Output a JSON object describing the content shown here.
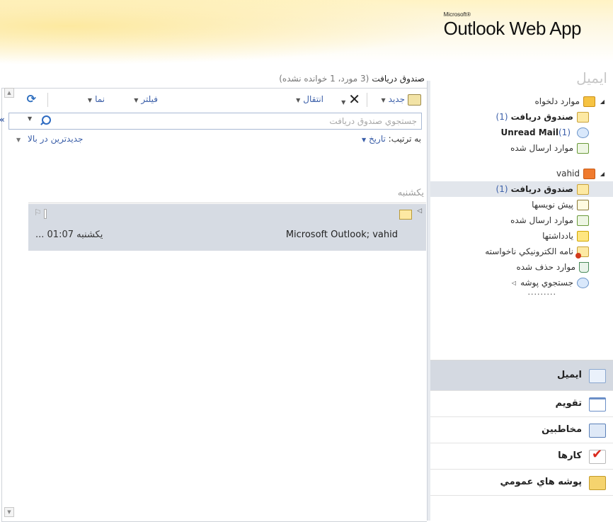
{
  "header": {
    "brand_small": "Microsoft®",
    "brand_app": "Outlook Web App"
  },
  "folder_pane": {
    "title": "ايميل",
    "favorites": {
      "label": "موارد دلخواه",
      "items": [
        {
          "label": "صندوق دريافت",
          "count": "(1)",
          "bold": true,
          "icon": "inbox-icon"
        },
        {
          "label": "Unread Mail",
          "count": "(1)",
          "bold": true,
          "icon": "search-folder-icon"
        },
        {
          "label": "موارد ارسال شده",
          "count": "",
          "bold": false,
          "icon": "sent-icon"
        }
      ]
    },
    "mailbox": {
      "label": "vahid",
      "items": [
        {
          "label": "صندوق دريافت",
          "count": "(1)",
          "bold": true,
          "selected": true,
          "icon": "inbox-icon"
        },
        {
          "label": "پيش نويسها",
          "count": "",
          "bold": false,
          "icon": "drafts-icon"
        },
        {
          "label": "موارد ارسال شده",
          "count": "",
          "bold": false,
          "icon": "sent-icon"
        },
        {
          "label": "يادداشتها",
          "count": "",
          "bold": false,
          "icon": "notes-icon"
        },
        {
          "label": "نامه الكترونيكي ناخواسته",
          "count": "",
          "bold": false,
          "icon": "junk-icon"
        },
        {
          "label": "موارد حذف شده",
          "count": "",
          "bold": false,
          "icon": "trash-icon"
        },
        {
          "label": "جستجوي پوشه",
          "count": "",
          "bold": false,
          "icon": "search-folder-icon"
        }
      ],
      "more": "........."
    }
  },
  "nav": {
    "mail": "ايميل",
    "calendar": "تقويم",
    "contacts": "مخاطبين",
    "tasks": "كارها",
    "public": "پوشه هاي عمومي"
  },
  "list": {
    "title": "صندوق دريافت",
    "counts": "(3 مورد، 1 خوانده نشده)",
    "toolbar": {
      "new": "جديد",
      "move": "انتقال",
      "filter": "فيلتر",
      "view": "نما"
    },
    "search": {
      "placeholder": "جستجوي صندوق دريافت"
    },
    "sort": {
      "label": "به ترتيب:",
      "value": "تاريخ",
      "order": "جديدترين در بالا"
    },
    "group": "يكشنبه",
    "messages": [
      {
        "sender": "Microsoft Outlook; vahid",
        "time": "يكشنبه 01:07 ..."
      }
    ]
  },
  "colors": {
    "accent": "#3a5ea8",
    "selected": "#d6dbe3"
  }
}
